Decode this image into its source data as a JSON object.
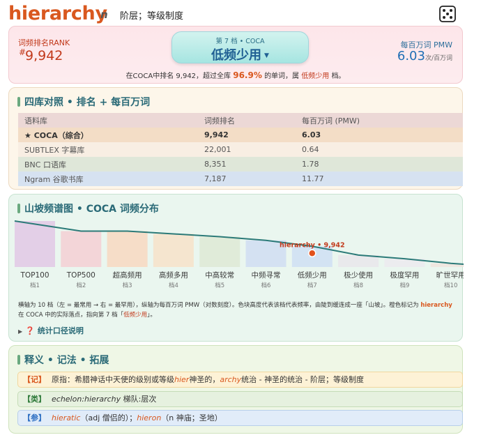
{
  "header": {
    "word": "hierarchy",
    "pos": "n",
    "gloss": "阶层；等级制度",
    "dice_icon": "dice-icon"
  },
  "overview": {
    "rank_label": "词频排名RANK",
    "rank_hash": "#",
    "rank_value": "9,942",
    "band_sub": "第 7 档 • COCA",
    "band_main": "低频少用",
    "pmw_label": "每百万词 PMW",
    "pmw_value": "6.03",
    "pmw_unit": "次/百万词",
    "summary_pre": "在COCA中排名 9,942，超过全库",
    "summary_pct": "96.9%",
    "summary_mid": "的单词，属",
    "summary_band": "低频少用",
    "summary_post": "档。"
  },
  "compare": {
    "title": "四库对照 • 排名 + 每百万词",
    "headers": [
      "语料库",
      "词频排名",
      "每百万词 (PMW)"
    ],
    "rows": [
      [
        "★ COCA（综合）",
        "9,942",
        "6.03"
      ],
      [
        "SUBTLEX 字幕库",
        "22,001",
        "0.64"
      ],
      [
        "BNC 口语库",
        "8,351",
        "1.78"
      ],
      [
        "Ngram 谷歌书库",
        "7,187",
        "11.77"
      ]
    ]
  },
  "chart": {
    "title": "山坡频谱图 • COCA 词频分布",
    "marker_label": "hierarchy • 9,942",
    "note_line1": "横轴为 10 档（左 = 最常用 → 右 = 最罕用），纵轴为每百万词 PMW（对数刻度）。色块高度代表该档代表频率，由陡到缓连成一座「山坡」。橙色标记为",
    "note_word": "hierarchy",
    "note_line2": "在 COCA 中的实际落点，指向第 7 档「",
    "note_band": "低频少用",
    "note_end": "」。",
    "stat_link": "统计口径说明"
  },
  "chart_data": {
    "type": "area",
    "categories": [
      "TOP100",
      "TOP500",
      "超高频用",
      "高频多用",
      "中高较常",
      "中频寻常",
      "低频少用",
      "极少使用",
      "极度罕用",
      "旷世罕用"
    ],
    "tiers": [
      "档1",
      "档2",
      "档3",
      "档4",
      "档5",
      "档6",
      "档7",
      "档8",
      "档9",
      "档10"
    ],
    "levels": [
      1.0,
      0.78,
      0.78,
      0.72,
      0.66,
      0.58,
      0.45,
      0.26,
      0.18,
      0.08
    ],
    "highlight_index": 6,
    "colors": [
      "#e3cfe7",
      "#f3d5d8",
      "#f6ddc8",
      "#f5e5cf",
      "#e0ebd9",
      "#d4e1f2",
      "#d3e3f3",
      "#e9e9ec",
      "#ececef",
      "#efe7e0"
    ],
    "marker_color": "#e2521c",
    "line_color": "#2b7a78"
  },
  "meaning": {
    "title": "释义 • 记法 • 拓展",
    "row1_tag": "【记】",
    "row1_a": "原指：希腊神话中天使的级别或等级",
    "row1_b": "hier",
    "row1_c": "神圣的，",
    "row1_d": "archy",
    "row1_e": "统治 - 神圣的统治 - 阶层；等级制度",
    "row2_tag": "【类】",
    "row2_a": "echelon:hierarchy",
    "row2_b": " 梯队:层次",
    "row3_tag": "【参】",
    "row3_a": "hieratic",
    "row3_b": "（adj 僧侣的）；",
    "row3_c": "hieron",
    "row3_d": "（n 神庙；圣地）"
  }
}
